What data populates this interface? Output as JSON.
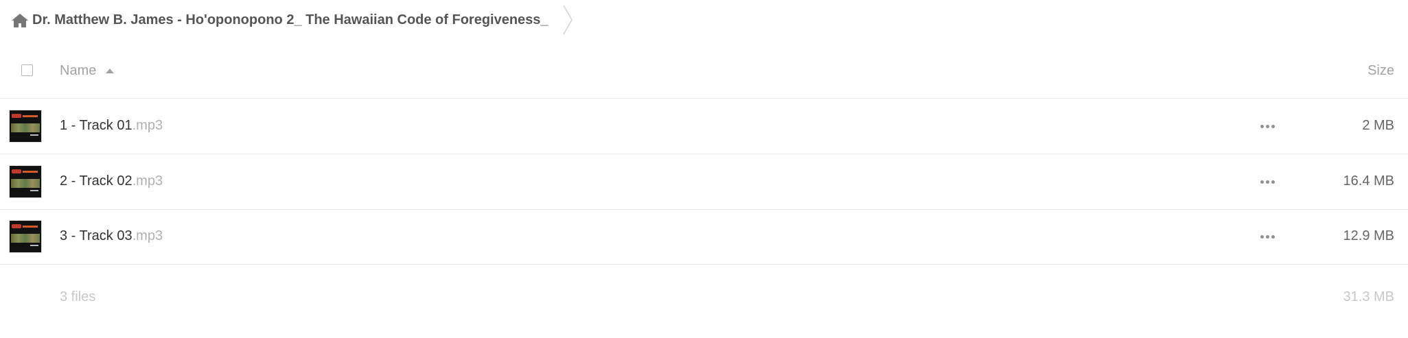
{
  "breadcrumb": {
    "home_icon": "home-icon",
    "title": "Dr. Matthew B. James - Ho'oponopono 2_ The Hawaiian Code of Foregiveness_"
  },
  "header": {
    "name_label": "Name",
    "sort_icon": "sort-ascending-icon",
    "size_label": "Size"
  },
  "files": [
    {
      "base": "1 - Track 01",
      "ext": ".mp3",
      "size": "2 MB",
      "thumb_icon": "album-art-thumbnail",
      "menu_icon": "more-options-icon"
    },
    {
      "base": "2 - Track 02",
      "ext": ".mp3",
      "size": "16.4 MB",
      "thumb_icon": "album-art-thumbnail",
      "menu_icon": "more-options-icon"
    },
    {
      "base": "3 - Track 03",
      "ext": ".mp3",
      "size": "12.9 MB",
      "thumb_icon": "album-art-thumbnail",
      "menu_icon": "more-options-icon"
    }
  ],
  "summary": {
    "count": "3 files",
    "total_size": "31.3 MB"
  }
}
